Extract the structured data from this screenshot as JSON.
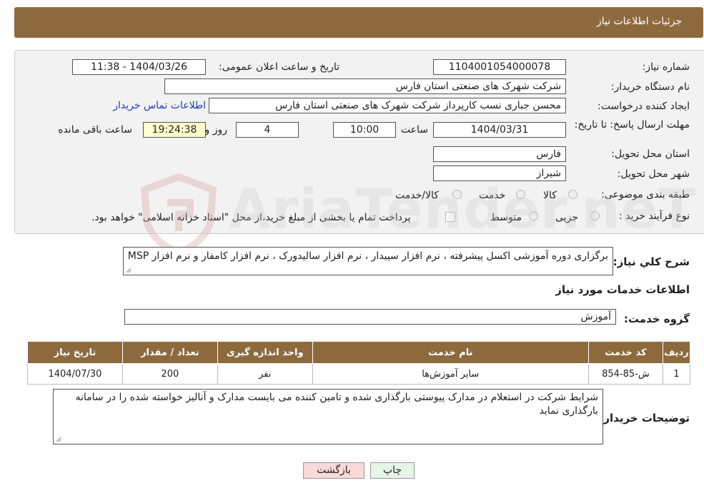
{
  "header": {
    "title": "جزئیات اطلاعات نیاز"
  },
  "form": {
    "need_number_label": "شماره نیاز:",
    "need_number": "1104001054000078",
    "announce_label": "تاریخ و ساعت اعلان عمومی:",
    "announce_value": "1404/03/26 - 11:38",
    "buyer_org_label": "نام دستگاه خریدار:",
    "buyer_org": "شرکت شهرک های صنعتی استان فارس",
    "creator_label": "ایجاد کننده درخواست:",
    "creator": "محسن  جباری نسب کارپرداز شرکت شهرک های صنعتی استان فارس",
    "contact_link": "اطلاعات تماس خریدار",
    "deadline_label": "مهلت ارسال پاسخ: تا تاریخ:",
    "deadline_date": "1404/03/31",
    "time_label": "ساعت",
    "deadline_time": "10:00",
    "days_value": "4",
    "days_label": "روز و",
    "remaining_time": "19:24:38",
    "remaining_label": "ساعت باقی مانده",
    "province_label": "استان محل تحویل:",
    "province": "فارس",
    "city_label": "شهر محل تحویل:",
    "city": "شیراز",
    "category_label": "طبقه بندی موضوعی:",
    "category_options": [
      "کالا",
      "خدمت",
      "کالا/خدمت"
    ],
    "purchase_type_label": "نوع فرآیند خرید :",
    "purchase_options": [
      "جزیی",
      "متوسط"
    ],
    "purchase_note": "پرداخت تمام یا بخشی از مبلغ خرید،از محل \"اسناد خزانه اسلامی\" خواهد بود."
  },
  "summary": {
    "label": "شرح کلي نياز:",
    "text": "برگزاری دوره آموزشی اکسل پیشرفته ، نرم افزار سپیدار ، نرم افزار سالیدورک ، نرم افزار کامفار و نرم افزار MSP"
  },
  "services": {
    "section_title": "اطلاعات خدمات مورد نياز",
    "group_label": "گروه خدمت:",
    "group_value": "آموزش",
    "columns": [
      "ردیف",
      "کد خدمت",
      "نام خدمت",
      "واحد اندازه گیری",
      "تعداد / مقدار",
      "تاریخ نیاز"
    ],
    "rows": [
      [
        "1",
        "ش-85-854",
        "سایر آموزش‌ها",
        "نفر",
        "200",
        "1404/07/30"
      ]
    ]
  },
  "buyer_notes": {
    "label": "توضیحات خریدار:",
    "text": "شرایط شرکت در استعلام در مدارک پیوستی بارگذاری شده و تامین کننده می بایست مدارک و آنالیز خواسته شده را در سامانه بارگذاری نماید"
  },
  "buttons": {
    "print": "چاپ",
    "back": "بازگشت"
  },
  "colors": {
    "header": "#8d6a3e",
    "link": "#1a3fbf",
    "back_button": "#f9d9d9",
    "print_button": "#e6f5e6"
  },
  "watermark": "AriaTender.neT"
}
